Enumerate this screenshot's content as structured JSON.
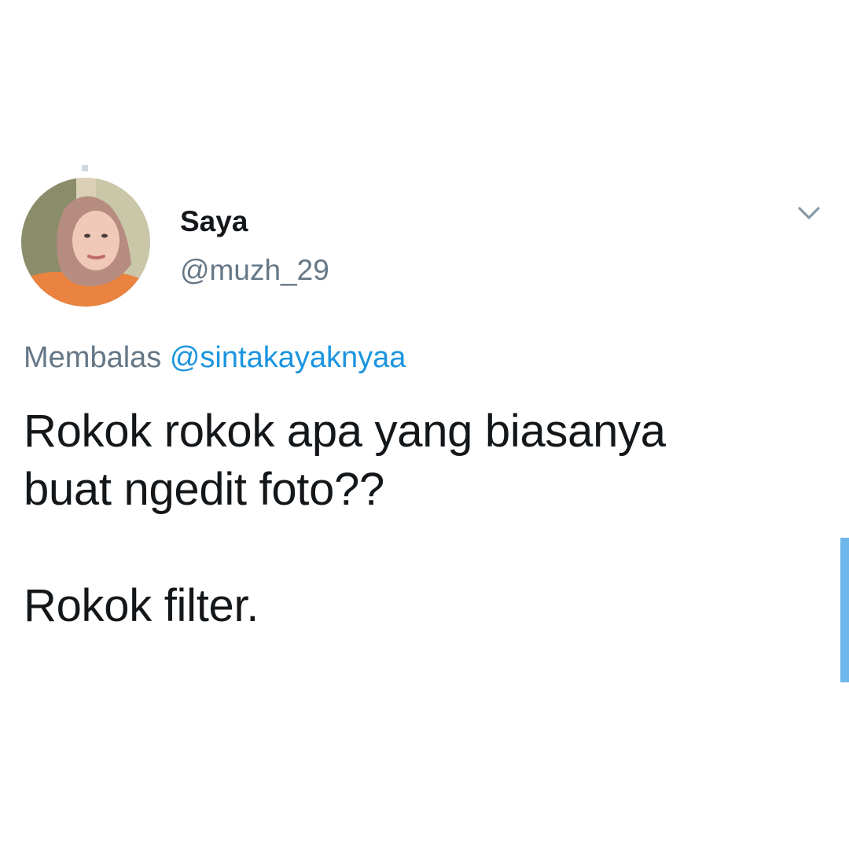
{
  "tweet": {
    "author": {
      "display_name": "Saya",
      "handle": "@muzh_29",
      "avatar_icon": "profile-photo"
    },
    "reply": {
      "label": "Membalas",
      "to_handle": "@sintakayaknyaa"
    },
    "text": {
      "line1": "Rokok rokok apa yang biasanya",
      "line2": "buat ngedit foto??",
      "line3": "Rokok filter."
    },
    "more_icon": "chevron-down-icon"
  },
  "colors": {
    "name": "#14171a",
    "secondary": "#657786",
    "link": "#1b95e0",
    "scroll_indicator": "#6fb7ea"
  }
}
